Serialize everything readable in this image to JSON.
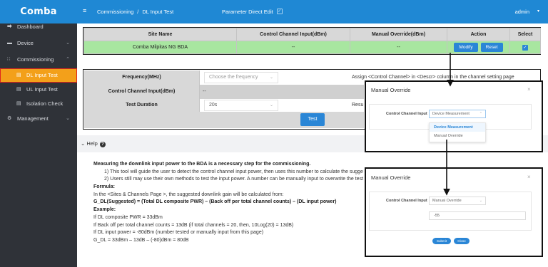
{
  "app": {
    "logo": "Comba"
  },
  "sidebar": {
    "items": [
      {
        "label": "Dashboard",
        "icon": "share-icon"
      },
      {
        "label": "Device",
        "icon": "monitor-icon",
        "chevron": "⌄"
      },
      {
        "label": "Commissioning",
        "icon": "grid-icon",
        "chevron": "⌃"
      },
      {
        "label": "DL Input Test",
        "icon": "document-icon",
        "active": true
      },
      {
        "label": "UL Input Test",
        "icon": "document-icon"
      },
      {
        "label": "Isolation Check",
        "icon": "document-icon"
      },
      {
        "label": "Management",
        "icon": "gear-icon",
        "chevron": "⌄"
      }
    ],
    "active_color": "#f3a01a",
    "highlight_box_color": "#e0261c"
  },
  "header": {
    "menu_icon": "≡",
    "breadcrumb": [
      "Commissioning",
      "/",
      "DL Input Test"
    ],
    "parameter_direct_edit": "Parameter Direct Edit",
    "user": "admin",
    "user_caret": "▾",
    "color": "#1f88d4"
  },
  "site_table": {
    "headers": [
      "Site Name",
      "Control Channel Input(dBm)",
      "Manual Override(dBm)",
      "Action",
      "Select"
    ],
    "row": {
      "site_name": "Comba Milpitas NG BDA",
      "control_channel_input": "--",
      "manual_override": "--",
      "modify_label": "Modify",
      "reset_label": "Reset",
      "select_checked": "✓"
    },
    "row_color": "#a8e6a0"
  },
  "form": {
    "frequency_label": "Frequency(MHz)",
    "frequency_placeholder": "Choose the frequency",
    "frequency_note": "Assign <Control Channel> in <Descr> column in the channel setting page",
    "control_channel_label": "Control Channel Input(dBm)",
    "control_channel_value": "--",
    "test_duration_label": "Test Duration",
    "test_duration_value": "20s",
    "test_duration_note": "Resu",
    "test_button": "Test"
  },
  "help": {
    "toggle_label": "Help",
    "lines": [
      "Measuring the downlink input power to the BDA is a necessary step for the commissioning.",
      "1) This tool will guide the user to detect the control channel input power, then uses this number to calculate the sugge",
      "2) Users still may use their own methods to test the input power. A number can be manually input to overwrite the test",
      "Formula:",
      "In the <Sites & Channels Page >, the suggested downlink gain will be calculated from:",
      "G_DL(Suggested) = (Total DL composite PWR) – (Back off per total channel counts) – (DL input power)",
      "Example:",
      "If DL composite PWR = 33dBm",
      "If Back off per total channel counts = 13dB (if total channels = 20, then, 10Log(20) = 13dB)",
      "If DL input power = -80dBm (number tested or manually input from this page)",
      "G_DL = 33dBm – 13dB – (-80)dBm = 80dB"
    ]
  },
  "popup_1": {
    "title": "Manual Override",
    "close": "×",
    "label": "Control Channel Input",
    "select_value": "Device Measurement",
    "options": [
      "Device Measurement",
      "Manual Override"
    ]
  },
  "popup_2": {
    "title": "Manual Override",
    "close": "×",
    "label": "Control Channel Input",
    "select_value": "Manual Override",
    "input_value": "-55",
    "submit_label": "Submit",
    "close_label": "Close"
  }
}
